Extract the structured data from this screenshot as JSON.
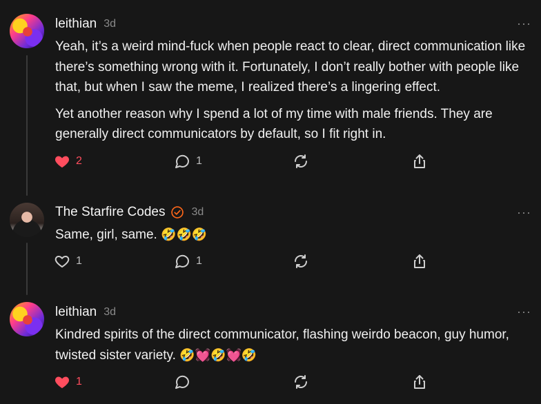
{
  "comments": [
    {
      "username": "leithian",
      "time": "3d",
      "more": "···",
      "paragraphs": [
        "Yeah, it’s a weird mind-fuck when people react to clear, direct communication like there’s something wrong with it. Fortunately, I don’t really bother with people like that, but when I saw the meme, I realized there’s a lingering effect.",
        "Yet another reason why I spend a lot of my time with male friends. They are generally direct communicators by default, so I fit right in."
      ],
      "likes": "2",
      "liked": true,
      "replies": "1"
    },
    {
      "username": "The Starfire Codes",
      "time": "3d",
      "more": "···",
      "text": "Same, girl, same.",
      "emojis": "🤣🤣🤣",
      "likes": "1",
      "liked": false,
      "replies": "1"
    },
    {
      "username": "leithian",
      "time": "3d",
      "more": "···",
      "text": "Kindred spirits of the direct communicator, flashing weirdo beacon, guy humor, twisted sister variety.",
      "emojis": "🤣💓🤣💓🤣",
      "likes": "1",
      "liked": true,
      "replies": ""
    }
  ],
  "colors": {
    "background": "#171717",
    "like_red": "#ff4d5e",
    "verified_orange": "#ff6719"
  }
}
